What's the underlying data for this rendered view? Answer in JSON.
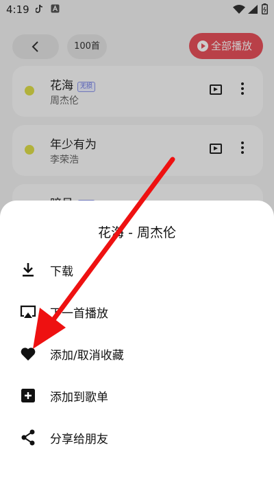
{
  "status_bar": {
    "time": "4:19"
  },
  "header": {
    "count_label": "100首",
    "play_all_label": "全部播放"
  },
  "songs": [
    {
      "title": "花海",
      "tag": "无损",
      "artist": "周杰伦"
    },
    {
      "title": "年少有为",
      "tag": "",
      "artist": "李荣浩"
    },
    {
      "title": "暗号",
      "tag": "无损",
      "artist": ""
    }
  ],
  "sheet": {
    "title": "花海 - 周杰伦",
    "items": [
      {
        "label": "下载",
        "icon": "download-icon"
      },
      {
        "label": "下一首播放",
        "icon": "cast-icon"
      },
      {
        "label": "添加/取消收藏",
        "icon": "heart-icon"
      },
      {
        "label": "添加到歌单",
        "icon": "add-box-icon"
      },
      {
        "label": "分享给朋友",
        "icon": "share-icon"
      }
    ]
  },
  "colors": {
    "accent": "#e8505b",
    "dot": "#dede4a",
    "arrow": "#ee1111"
  }
}
